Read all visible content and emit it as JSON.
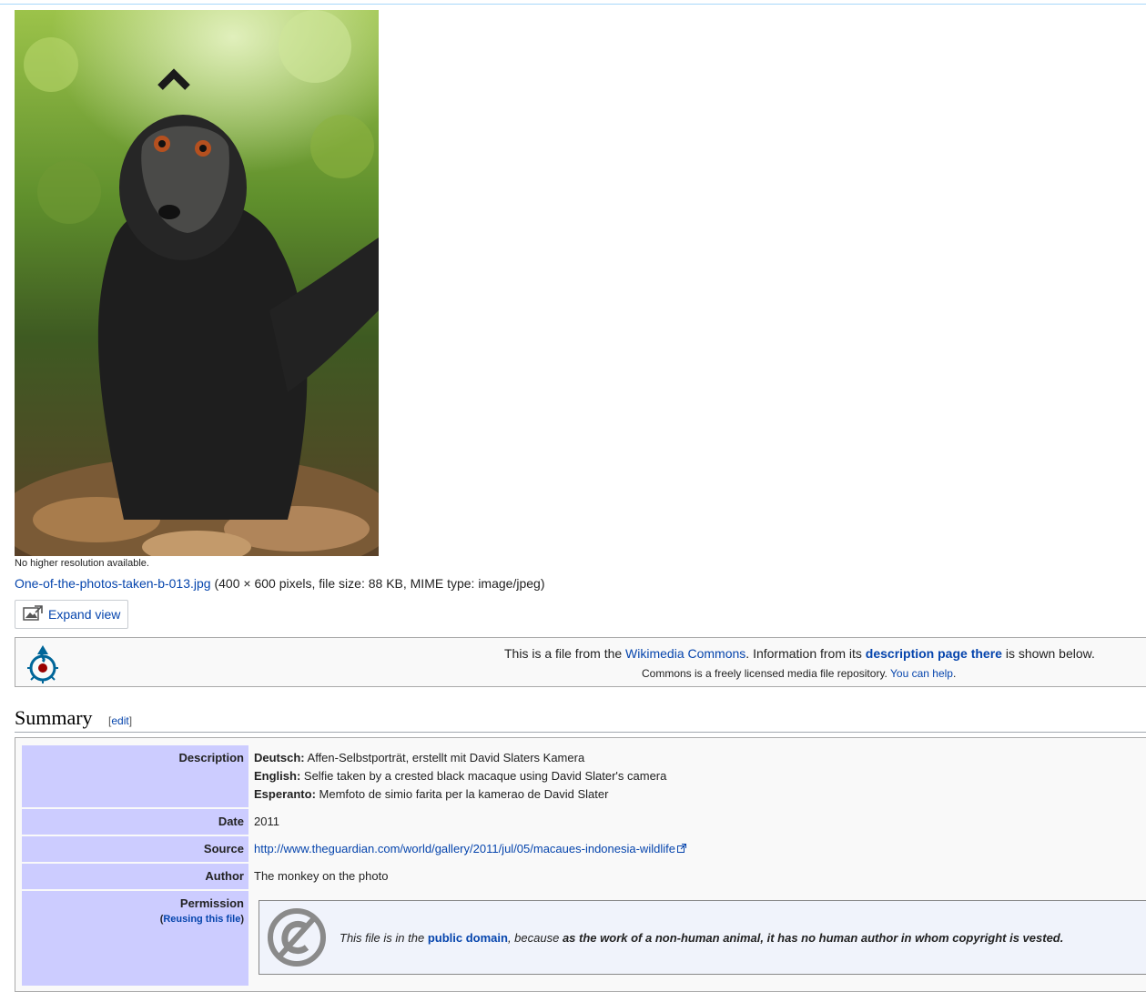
{
  "photo": {
    "caption": "No higher resolution available."
  },
  "file": {
    "name": "One-of-the-photos-taken-b-013.jpg",
    "details": "(400 × 600 pixels, file size: 88 KB, MIME type: image/jpeg)"
  },
  "expand_button": {
    "label": "Expand view",
    "icon": "expand-image-icon"
  },
  "commons_notice": {
    "line1_pre": "This is a file from the ",
    "line1_link": "Wikimedia Commons",
    "line1_mid": ". Information from its ",
    "line1_bold_link": "description page there",
    "line1_post": " is shown below.",
    "line2_pre": "Commons is a freely licensed media file repository. ",
    "line2_link": "You can help",
    "line2_post": "."
  },
  "summary": {
    "title": "Summary",
    "edit_open": "[",
    "edit_link": "edit",
    "edit_close": "]"
  },
  "info": {
    "description_label": "Description",
    "descriptions": [
      {
        "lang": "Deutsch:",
        "text": " Affen-Selbstporträt, erstellt mit David Slaters Kamera"
      },
      {
        "lang": "English:",
        "text": " Selfie taken by a crested black macaque using David Slater's camera"
      },
      {
        "lang": "Esperanto:",
        "text": " Memfoto de simio farita per la kamerao de David Slater"
      }
    ],
    "date_label": "Date",
    "date_value": "2011",
    "source_label": "Source",
    "source_link": "http://www.theguardian.com/world/gallery/2011/jul/05/macaues-indonesia-wildlife",
    "author_label": "Author",
    "author_value": "The monkey on the photo",
    "permission_label": "Permission",
    "reuse_open": "(",
    "reuse_link": "Reusing this file",
    "reuse_close": ")",
    "pd": {
      "pre": "This file is in the ",
      "link": "public domain",
      "mid": ", because ",
      "bold": "as the work of a non-human animal, it has no human author in whom copyright is vested."
    }
  },
  "colors": {
    "link": "#0645ad",
    "label_bg": "#ccccff",
    "panel_bg": "#f9f9f9"
  }
}
